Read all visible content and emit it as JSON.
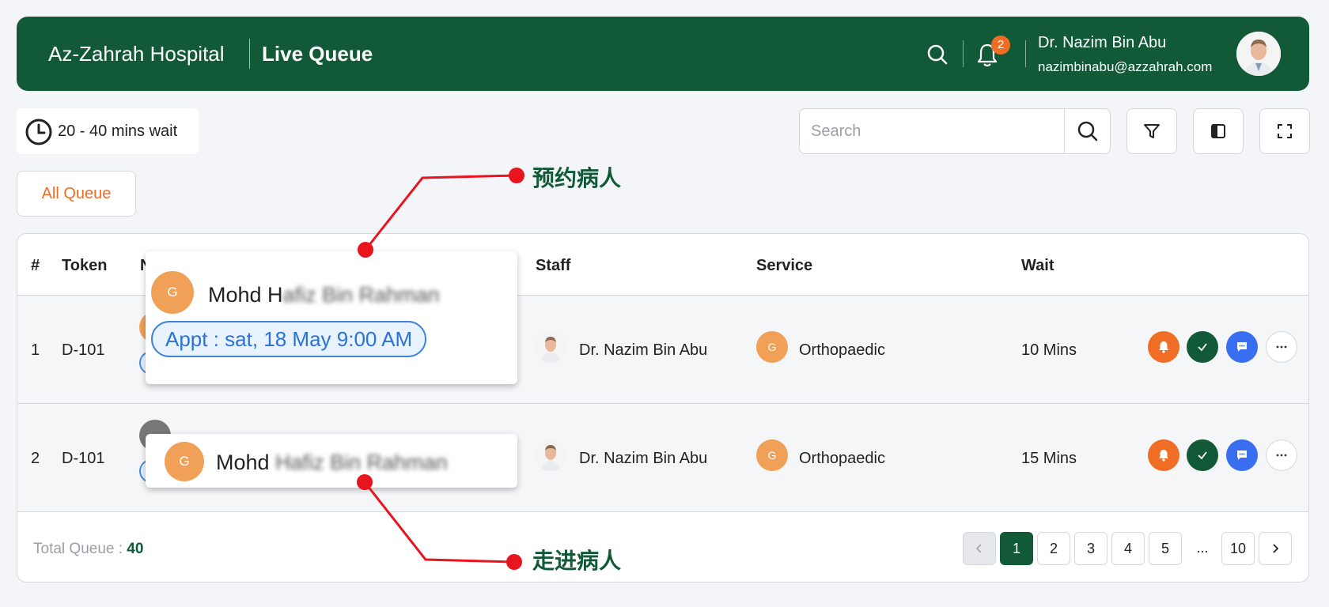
{
  "header": {
    "hospital_name": "Az-Zahrah Hospital",
    "page_title": "Live Queue",
    "notification_count": "2",
    "user_name": "Dr. Nazim Bin Abu",
    "user_email": "nazimbinabu@azzahrah.com"
  },
  "toolbar": {
    "wait_text": "20 - 40 mins wait",
    "search_placeholder": "Search",
    "tab_all": "All Queue"
  },
  "table": {
    "columns": [
      "#",
      "Token",
      "N",
      "Staff",
      "Service",
      "Wait"
    ],
    "rows": [
      {
        "num": "1",
        "token": "D-101",
        "staff": "Dr. Nazim Bin Abu",
        "service_initial": "G",
        "service": "Orthopaedic",
        "wait": "10 Mins"
      },
      {
        "num": "2",
        "token": "D-101",
        "staff": "Dr. Nazim Bin Abu",
        "service_initial": "G",
        "service": "Orthopaedic",
        "wait": "15 Mins"
      }
    ]
  },
  "footer": {
    "total_label": "Total Queue : ",
    "total_value": "40",
    "pages": [
      "1",
      "2",
      "3",
      "4",
      "5",
      "...",
      "10"
    ]
  },
  "popups": {
    "appointment": {
      "initial": "G",
      "name_visible": "Mohd H",
      "name_blurred": "afiz Bin Rahman",
      "appt": "Appt : sat, 18 May 9:00 AM"
    },
    "walkin": {
      "initial": "G",
      "name_visible": "Mohd ",
      "name_blurred": "Hafiz Bin Rahman"
    }
  },
  "annotations": {
    "appointment_label": "预约病人",
    "walkin_label": "走进病人"
  },
  "colors": {
    "brand": "#125a37",
    "accent": "#f06d25",
    "link": "#2a73d6"
  }
}
